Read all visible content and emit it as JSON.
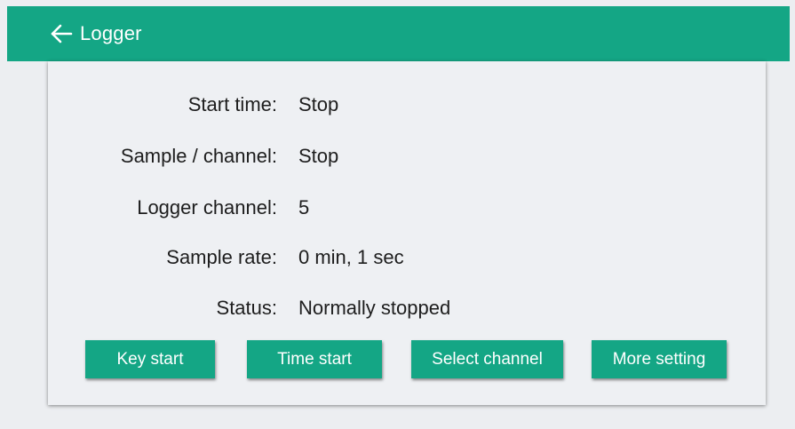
{
  "header": {
    "title": "Logger",
    "back_icon": "arrow-left-icon",
    "color": "#14a685"
  },
  "fields": [
    {
      "label": "Start time:",
      "value": "Stop"
    },
    {
      "label": "Sample / channel:",
      "value": "Stop"
    },
    {
      "label": "Logger channel:",
      "value": "5"
    },
    {
      "label": "Sample rate:",
      "value": "0 min, 1 sec"
    },
    {
      "label": "Status:",
      "value": "Normally stopped"
    }
  ],
  "buttons": {
    "key_start": "Key start",
    "time_start": "Time start",
    "select_channel": "Select channel",
    "more_setting": "More setting"
  }
}
